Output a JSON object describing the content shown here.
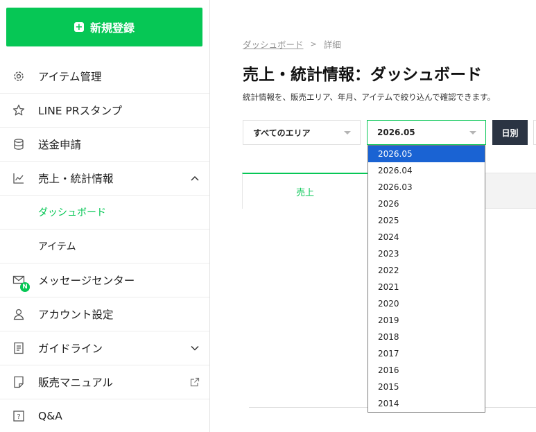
{
  "sidebar": {
    "new_button_label": "新規登録",
    "items": [
      {
        "label": "アイテム管理"
      },
      {
        "label": "LINE PRスタンプ"
      },
      {
        "label": "送金申請"
      },
      {
        "label": "売上・統計情報"
      },
      {
        "label": "ダッシュボード"
      },
      {
        "label": "アイテム"
      },
      {
        "label": "メッセージセンター",
        "badge": "N"
      },
      {
        "label": "アカウント設定"
      },
      {
        "label": "ガイドライン"
      },
      {
        "label": "販売マニュアル"
      },
      {
        "label": "Q&A"
      }
    ]
  },
  "breadcrumb": {
    "dashboard": "ダッシュボード",
    "separator": ">",
    "current": "詳細"
  },
  "page": {
    "title": "売上・統計情報：ダッシュボード",
    "description": "統計情報を、販売エリア、年月、アイテムで絞り込んで確認できます。"
  },
  "filters": {
    "area_selected": "すべてのエリア",
    "month_selected": "2026.05",
    "daily_button": "日別",
    "month_options": [
      "2026.05",
      "2026.04",
      "2026.03",
      "2026",
      "2025",
      "2024",
      "2023",
      "2022",
      "2021",
      "2020",
      "2019",
      "2018",
      "2017",
      "2016",
      "2015",
      "2014"
    ]
  },
  "tabs": {
    "sales": "売上"
  },
  "colors": {
    "brand_green": "#06c755",
    "dark_button": "#2b3443",
    "selected_blue": "#1a63d3"
  }
}
